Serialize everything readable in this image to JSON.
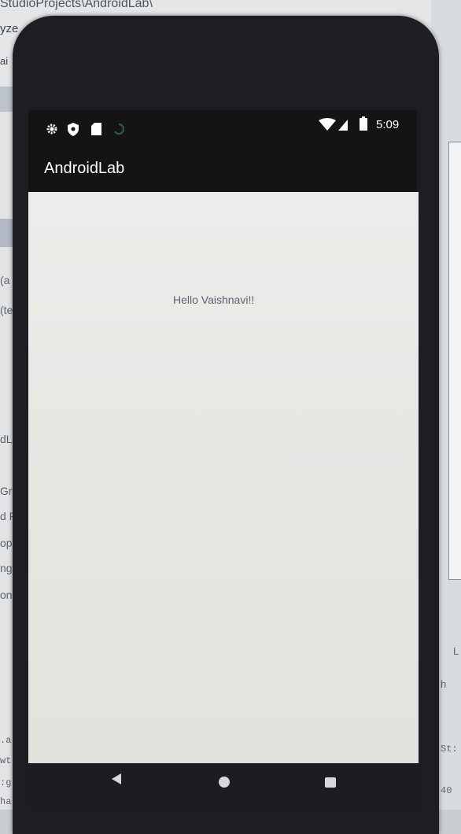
{
  "ide": {
    "crumb_text": "StudioProjects\\AndroidLab\\",
    "menu_analyze": "yze",
    "tab_text": "ai",
    "left_fragments": [
      "(a",
      "(te",
      "dLa",
      "Gra",
      "d F",
      "ope",
      "ngs",
      "on)"
    ],
    "left_code": [
      ".a",
      "wt",
      ":g",
      "ha"
    ],
    "right_fragments": [
      "L",
      "h"
    ],
    "right_code": [
      "St:",
      "40"
    ]
  },
  "status_bar": {
    "icons": [
      "settings-icon",
      "shield-icon",
      "sd-card-icon",
      "sync-icon",
      "wifi-icon",
      "signal-icon",
      "battery-icon"
    ],
    "time": "5:09"
  },
  "app_bar": {
    "title": "AndroidLab"
  },
  "content": {
    "message": "Hello Vaishnavi!!"
  },
  "nav_bar": {
    "buttons": [
      "back",
      "home",
      "recents"
    ]
  }
}
